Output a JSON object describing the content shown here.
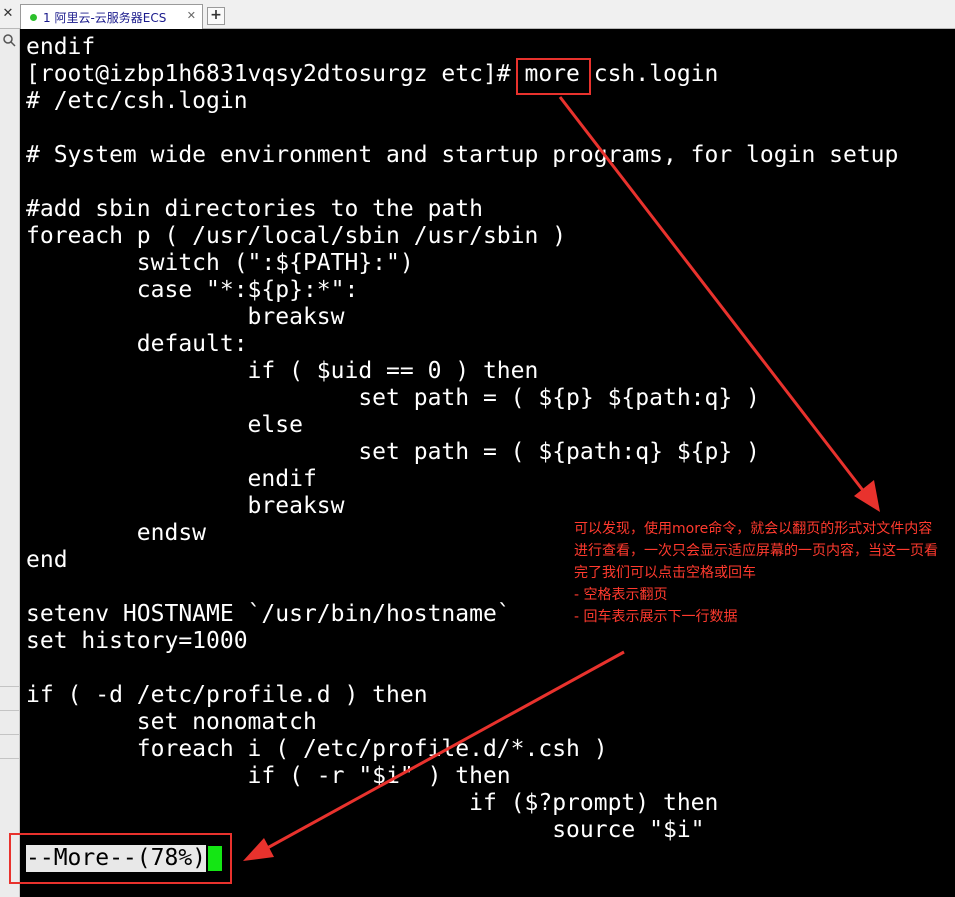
{
  "tabbar": {
    "close_all_label": "✕",
    "tab_label": "1 阿里云-云服务器ECS",
    "tab_close_label": "✕",
    "new_tab_label": "+"
  },
  "leftstrip": {
    "search_icon": "search-icon"
  },
  "terminal": {
    "lines": [
      "endif",
      "[root@izbp1h6831vqsy2dtosurgz etc]# more csh.login",
      "# /etc/csh.login",
      "",
      "# System wide environment and startup programs, for login setup",
      "",
      "#add sbin directories to the path",
      "foreach p ( /usr/local/sbin /usr/sbin )",
      "        switch (\":${PATH}:\")",
      "        case \"*:${p}:*\":",
      "                breaksw",
      "        default:",
      "                if ( $uid == 0 ) then",
      "                        set path = ( ${p} ${path:q} )",
      "                else",
      "                        set path = ( ${path:q} ${p} )",
      "                endif",
      "                breaksw",
      "        endsw",
      "end",
      "",
      "setenv HOSTNAME `/usr/bin/hostname`",
      "set history=1000",
      "",
      "if ( -d /etc/profile.d ) then",
      "        set nonomatch",
      "        foreach i ( /etc/profile.d/*.csh )",
      "                if ( -r \"$i\" ) then",
      "                                if ($?prompt) then",
      "                                      source \"$i\""
    ],
    "more_prompt": "--More--(78%)"
  },
  "annotation": {
    "line1": "可以发现，使用more命令，就会以翻页的形式对文件内容进行查看，一次只会显示适应屏幕的一页内容，当这一页看完了我们可以点击空格或回车",
    "line2": "- 空格表示翻页",
    "line3": "- 回车表示展示下一行数据"
  },
  "colors": {
    "annotation_red": "#e8322d",
    "terminal_bg": "#000000",
    "terminal_fg": "#ffffff",
    "cursor_green": "#14e614"
  }
}
